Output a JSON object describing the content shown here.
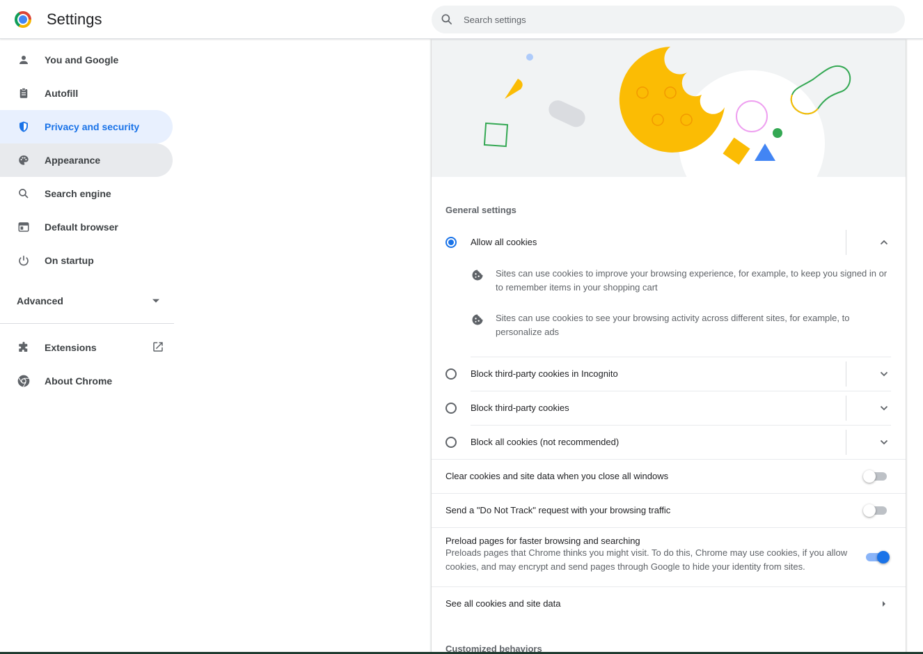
{
  "header": {
    "title": "Settings",
    "search_placeholder": "Search settings",
    "search_value": ""
  },
  "sidebar": {
    "items": [
      {
        "label": "You and Google",
        "icon": "person-icon"
      },
      {
        "label": "Autofill",
        "icon": "clipboard-icon"
      },
      {
        "label": "Privacy and security",
        "icon": "shield-icon",
        "active": true
      },
      {
        "label": "Appearance",
        "icon": "palette-icon"
      },
      {
        "label": "Search engine",
        "icon": "search-icon"
      },
      {
        "label": "Default browser",
        "icon": "browser-icon"
      },
      {
        "label": "On startup",
        "icon": "power-icon"
      }
    ],
    "advanced_label": "Advanced",
    "extensions_label": "Extensions",
    "about_label": "About Chrome"
  },
  "main": {
    "general_settings_title": "General settings",
    "cookie_options": [
      {
        "label": "Allow all cookies",
        "checked": true,
        "expanded": true
      },
      {
        "label": "Block third-party cookies in Incognito",
        "checked": false
      },
      {
        "label": "Block third-party cookies",
        "checked": false
      },
      {
        "label": "Block all cookies (not recommended)",
        "checked": false
      }
    ],
    "allow_all_details": [
      "Sites can use cookies to improve your browsing experience, for example, to keep you signed in or to remember items in your shopping cart",
      "Sites can use cookies to see your browsing activity across different sites, for example, to personalize ads"
    ],
    "toggles": [
      {
        "label": "Clear cookies and site data when you close all windows",
        "on": false
      },
      {
        "label": "Send a \"Do Not Track\" request with your browsing traffic",
        "on": false
      },
      {
        "label": "Preload pages for faster browsing and searching",
        "sub": "Preloads pages that Chrome thinks you might visit. To do this, Chrome may use cookies, if you allow cookies, and may encrypt and send pages through Google to hide your identity from sites.",
        "on": true
      }
    ],
    "see_all_label": "See all cookies and site data",
    "customized_behaviors_title": "Customized behaviors"
  },
  "colors": {
    "accent": "#1a73e8",
    "active_bg": "#e8f0fe",
    "hover_bg": "#e8eaed",
    "cookie_yellow": "#fbbc04"
  }
}
